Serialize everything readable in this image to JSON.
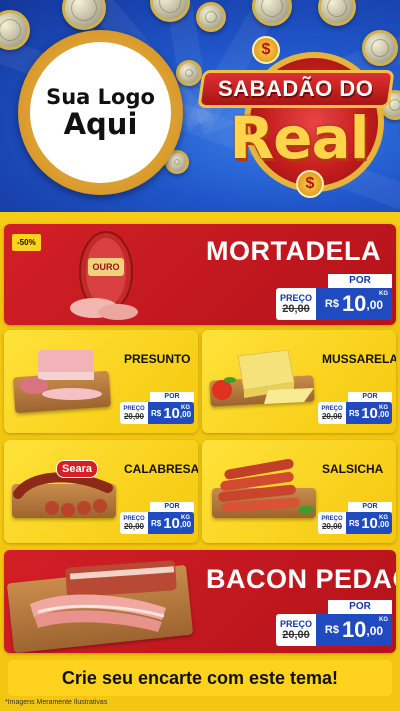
{
  "header": {
    "logo_line1": "Sua Logo",
    "logo_line2": "Aqui",
    "campaign_top": "SABADÃO DO",
    "campaign_main": "Real",
    "coin_symbol": "$"
  },
  "price_labels": {
    "por": "POR",
    "preco": "PREÇO",
    "currency": "R$",
    "unit": "KG"
  },
  "products": {
    "mortadela": {
      "name": "MORTADELA",
      "discount": "-50%",
      "brand": "OURO",
      "old_price": "20,00",
      "price_int": "10",
      "price_dec": ",00"
    },
    "presunto": {
      "name": "PRESUNTO",
      "old_price": "20,00",
      "price_int": "10",
      "price_dec": ",00"
    },
    "mussarela": {
      "name": "MUSSARELA",
      "old_price": "20,00",
      "price_int": "10",
      "price_dec": ",00"
    },
    "calabresa": {
      "name": "CALABRESA",
      "brand": "Seara",
      "old_price": "20,00",
      "price_int": "10",
      "price_dec": ",00"
    },
    "salsicha": {
      "name": "SALSICHA",
      "old_price": "20,00",
      "price_int": "10",
      "price_dec": ",00"
    },
    "bacon": {
      "name": "BACON PEDAÇO",
      "old_price": "20,00",
      "price_int": "10",
      "price_dec": ",00"
    }
  },
  "footer": {
    "cta": "Crie seu encarte com este tema!",
    "disclaimer": "*Imagens Meramente Ilustrativas"
  },
  "colors": {
    "blue_bg": "#1f55c9",
    "red_card": "#c9191f",
    "yellow_card": "#f5c80c",
    "price_blue": "#1f4ac0",
    "gold": "#e6b43c"
  }
}
